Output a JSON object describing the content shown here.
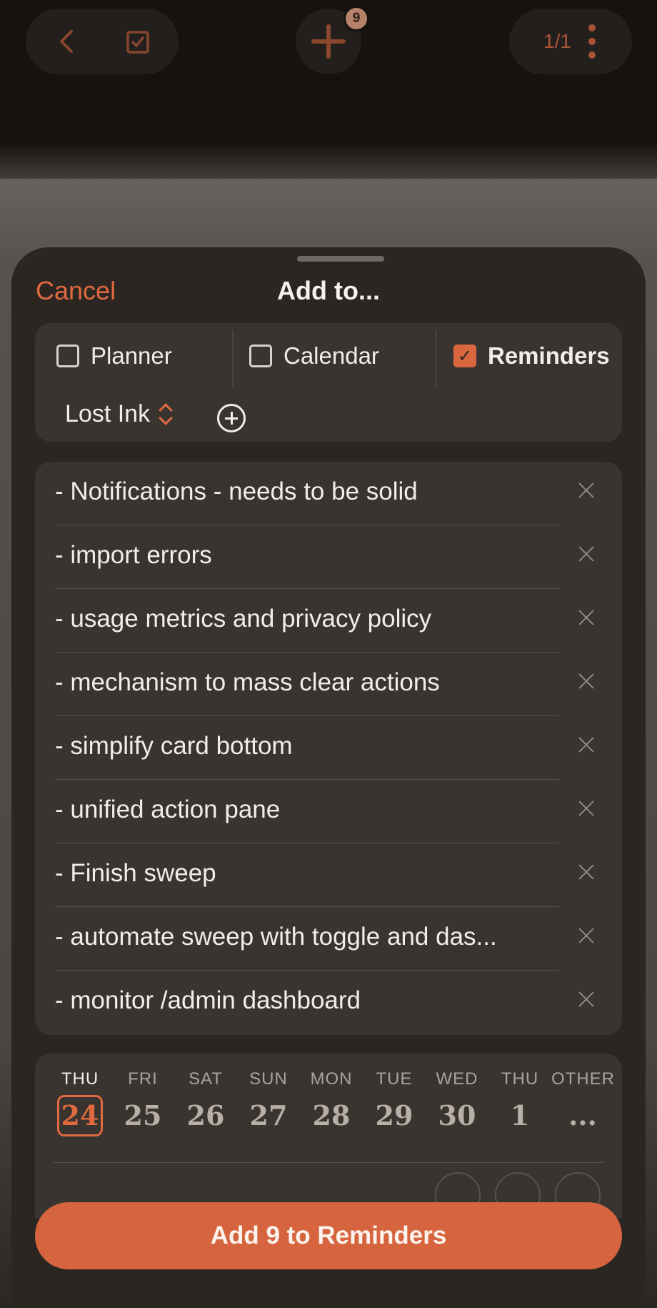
{
  "topbar": {
    "new_count": "9",
    "page_indicator": "1/1"
  },
  "sheet": {
    "cancel_label": "Cancel",
    "title": "Add to..."
  },
  "destinations": [
    {
      "label": "Planner",
      "checked": false
    },
    {
      "label": "Calendar",
      "checked": false
    },
    {
      "label": "Reminders",
      "checked": true
    }
  ],
  "list_selector": {
    "value": "Lost Ink"
  },
  "items": [
    "- Notifications - needs to be solid",
    "- import errors",
    "- usage metrics and privacy policy",
    "- mechanism to mass clear actions",
    "- simplify card bottom",
    "- unified action pane",
    "- Finish sweep",
    "- automate sweep with toggle and das...",
    "- monitor /admin dashboard"
  ],
  "dates": [
    {
      "day": "THU",
      "num": "24",
      "selected": true
    },
    {
      "day": "FRI",
      "num": "25",
      "selected": false
    },
    {
      "day": "SAT",
      "num": "26",
      "selected": false
    },
    {
      "day": "SUN",
      "num": "27",
      "selected": false
    },
    {
      "day": "MON",
      "num": "28",
      "selected": false
    },
    {
      "day": "TUE",
      "num": "29",
      "selected": false
    },
    {
      "day": "WED",
      "num": "30",
      "selected": false
    },
    {
      "day": "THU",
      "num": "1",
      "selected": false
    },
    {
      "day": "OTHER",
      "num": "...",
      "selected": false
    }
  ],
  "cta": {
    "label": "Add 9 to Reminders"
  },
  "colors": {
    "accent": "#d9663f",
    "sheet_bg": "#2b2622",
    "panel_bg": "#3a3430"
  }
}
